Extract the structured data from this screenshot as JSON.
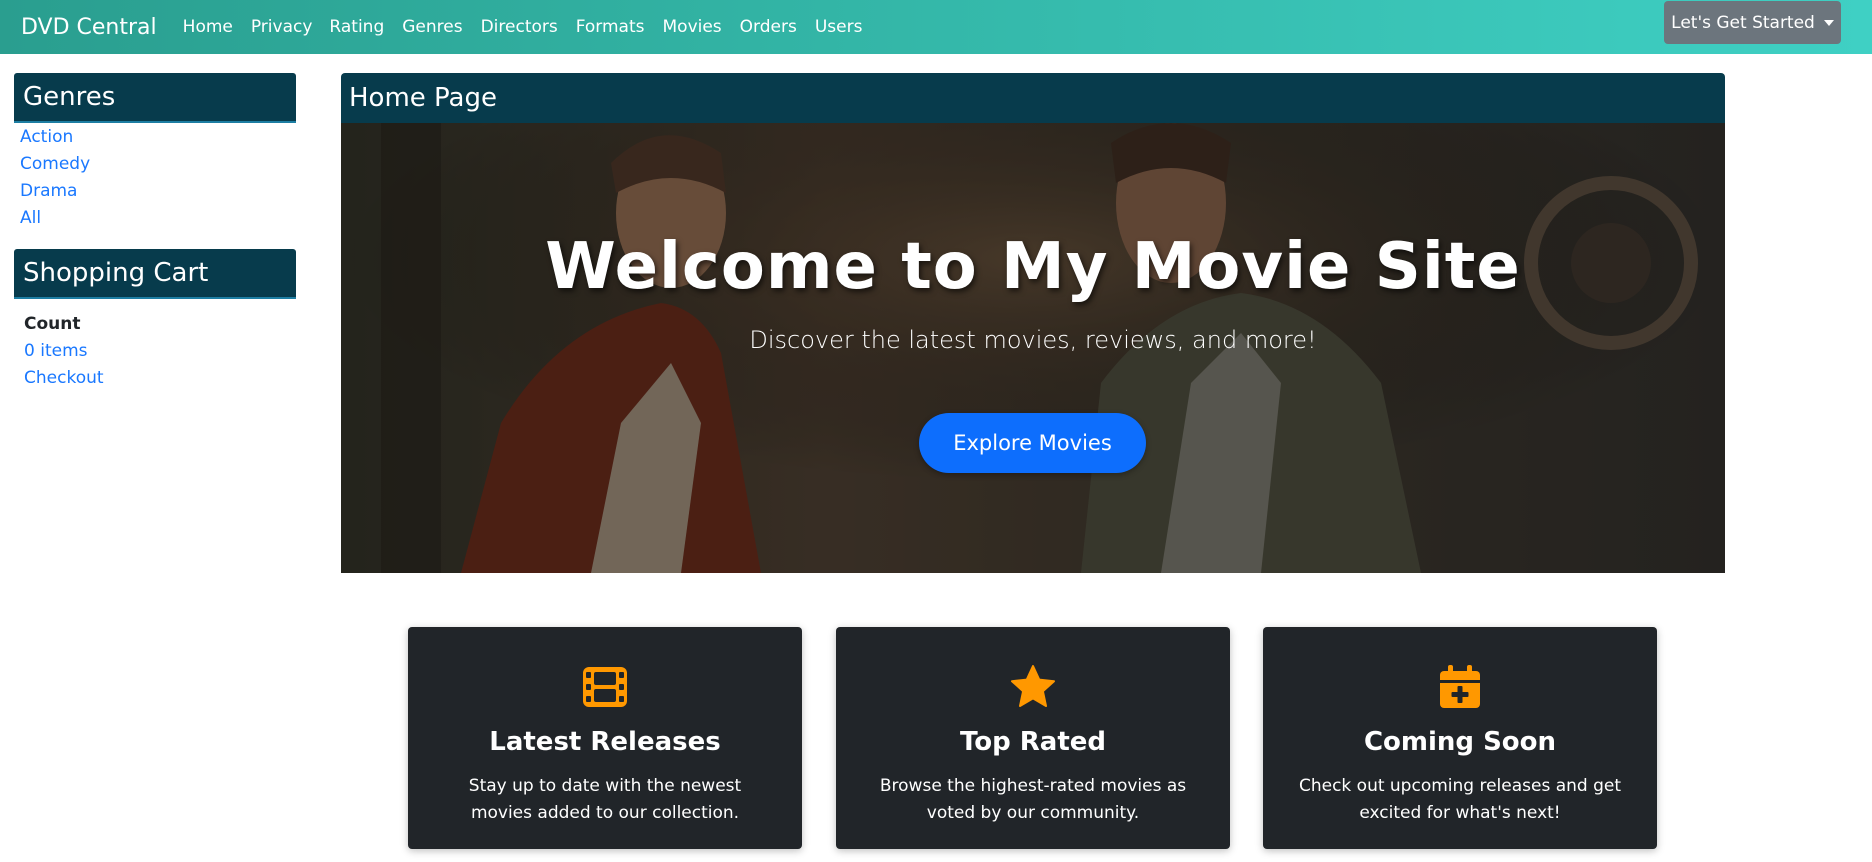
{
  "navbar": {
    "brand": "DVD Central",
    "links": [
      "Home",
      "Privacy",
      "Rating",
      "Genres",
      "Directors",
      "Formats",
      "Movies",
      "Orders",
      "Users"
    ],
    "dropdown_label": "Let's Get Started"
  },
  "sidebar": {
    "genres": {
      "title": "Genres",
      "items": [
        "Action",
        "Comedy",
        "Drama",
        "All"
      ]
    },
    "cart": {
      "title": "Shopping Cart",
      "count_label": "Count",
      "items_link": "0 items",
      "checkout_link": "Checkout"
    }
  },
  "main": {
    "title": "Home Page",
    "hero": {
      "title": "Welcome to My Movie Site",
      "subtitle": "Discover the latest movies, reviews, and more!",
      "button": "Explore Movies"
    },
    "cards": [
      {
        "icon": "film-icon",
        "title": "Latest Releases",
        "text": "Stay up to date with the newest movies added to our collection."
      },
      {
        "icon": "star-icon",
        "title": "Top Rated",
        "text": "Browse the highest-rated movies as voted by our community."
      },
      {
        "icon": "calendar-plus-icon",
        "title": "Coming Soon",
        "text": "Check out upcoming releases and get excited for what's next!"
      }
    ]
  },
  "colors": {
    "navbar_start": "#2a9e8f",
    "navbar_end": "#3fd0c4",
    "panel_header": "#073b4c",
    "link": "#1a78ff",
    "primary_button": "#0d6efd",
    "card_bg": "#212529",
    "icon_accent": "#ff9800"
  }
}
